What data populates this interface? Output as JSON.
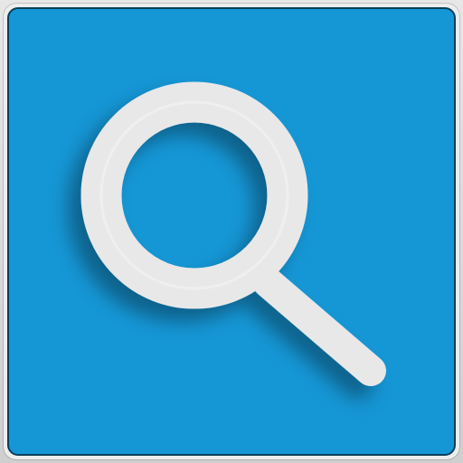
{
  "icon": {
    "name": "search-icon",
    "background_color": "#1596d5",
    "glyph_color": "#e8e8e8"
  }
}
